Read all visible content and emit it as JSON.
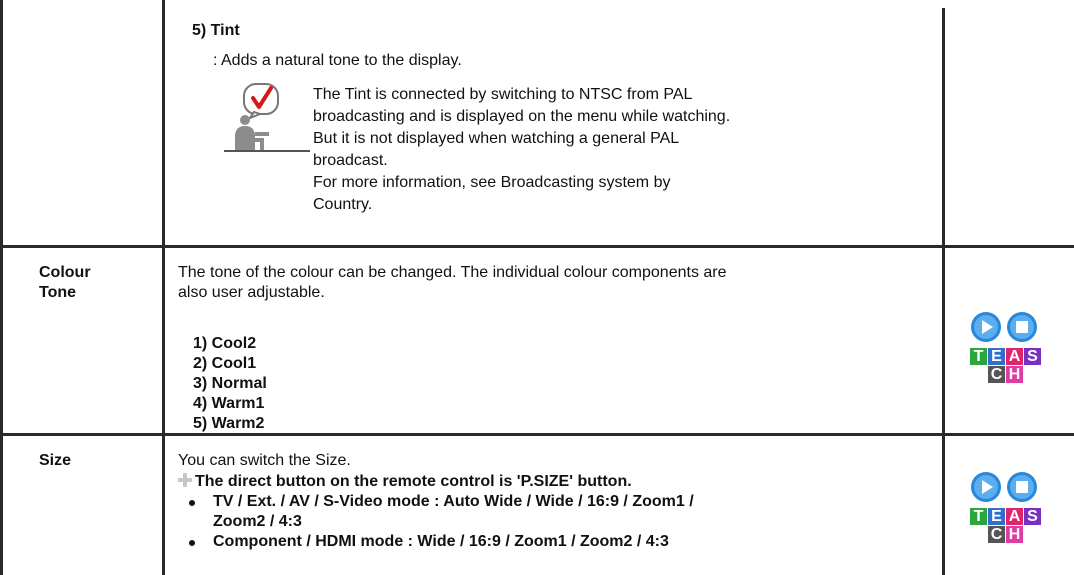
{
  "tint": {
    "title": "5) Tint",
    "description": ": Adds a natural tone to the display.",
    "note_icon": "note-checkmark-icon",
    "note_lines": [
      "The Tint is connected by switching to NTSC from PAL",
      "broadcasting and is displayed on the menu while watching.",
      "But it is not displayed when watching a general PAL",
      "broadcast.",
      "For more information, see Broadcasting system by",
      "Country."
    ]
  },
  "colour_tone": {
    "label_line1": "Colour",
    "label_line2": "Tone",
    "text_line1": "The tone of the colour can be changed. The individual colour components are",
    "text_line2": "also user adjustable.",
    "options": [
      "1) Cool2",
      "2) Cool1",
      "3) Normal",
      "4) Warm1",
      "5) Warm2"
    ]
  },
  "size": {
    "label": "Size",
    "text": "You can switch the Size.",
    "remote_note": "The direct button on the remote control is 'P.SIZE' button.",
    "bullet1_line1": "TV / Ext. / AV / S-Video mode : Auto Wide / Wide / 16:9 / Zoom1 /",
    "bullet1_line2": "Zoom2 / 4:3",
    "bullet2": "Component / HDMI mode : Wide / 16:9 / Zoom1 / Zoom2 / 4:3"
  },
  "teach_icon": {
    "play_icon": "play-circle-icon",
    "stop_icon": "stop-circle-icon",
    "letters": [
      "T",
      "E",
      "A",
      "S",
      "C",
      "H"
    ],
    "colors": {
      "circle": "#2a87d8",
      "T": "#2aa63c",
      "E": "#2f6fd0",
      "A": "#e0246c",
      "S": "#7a2fc0",
      "C": "#555555",
      "H": "#e03ca8"
    }
  }
}
